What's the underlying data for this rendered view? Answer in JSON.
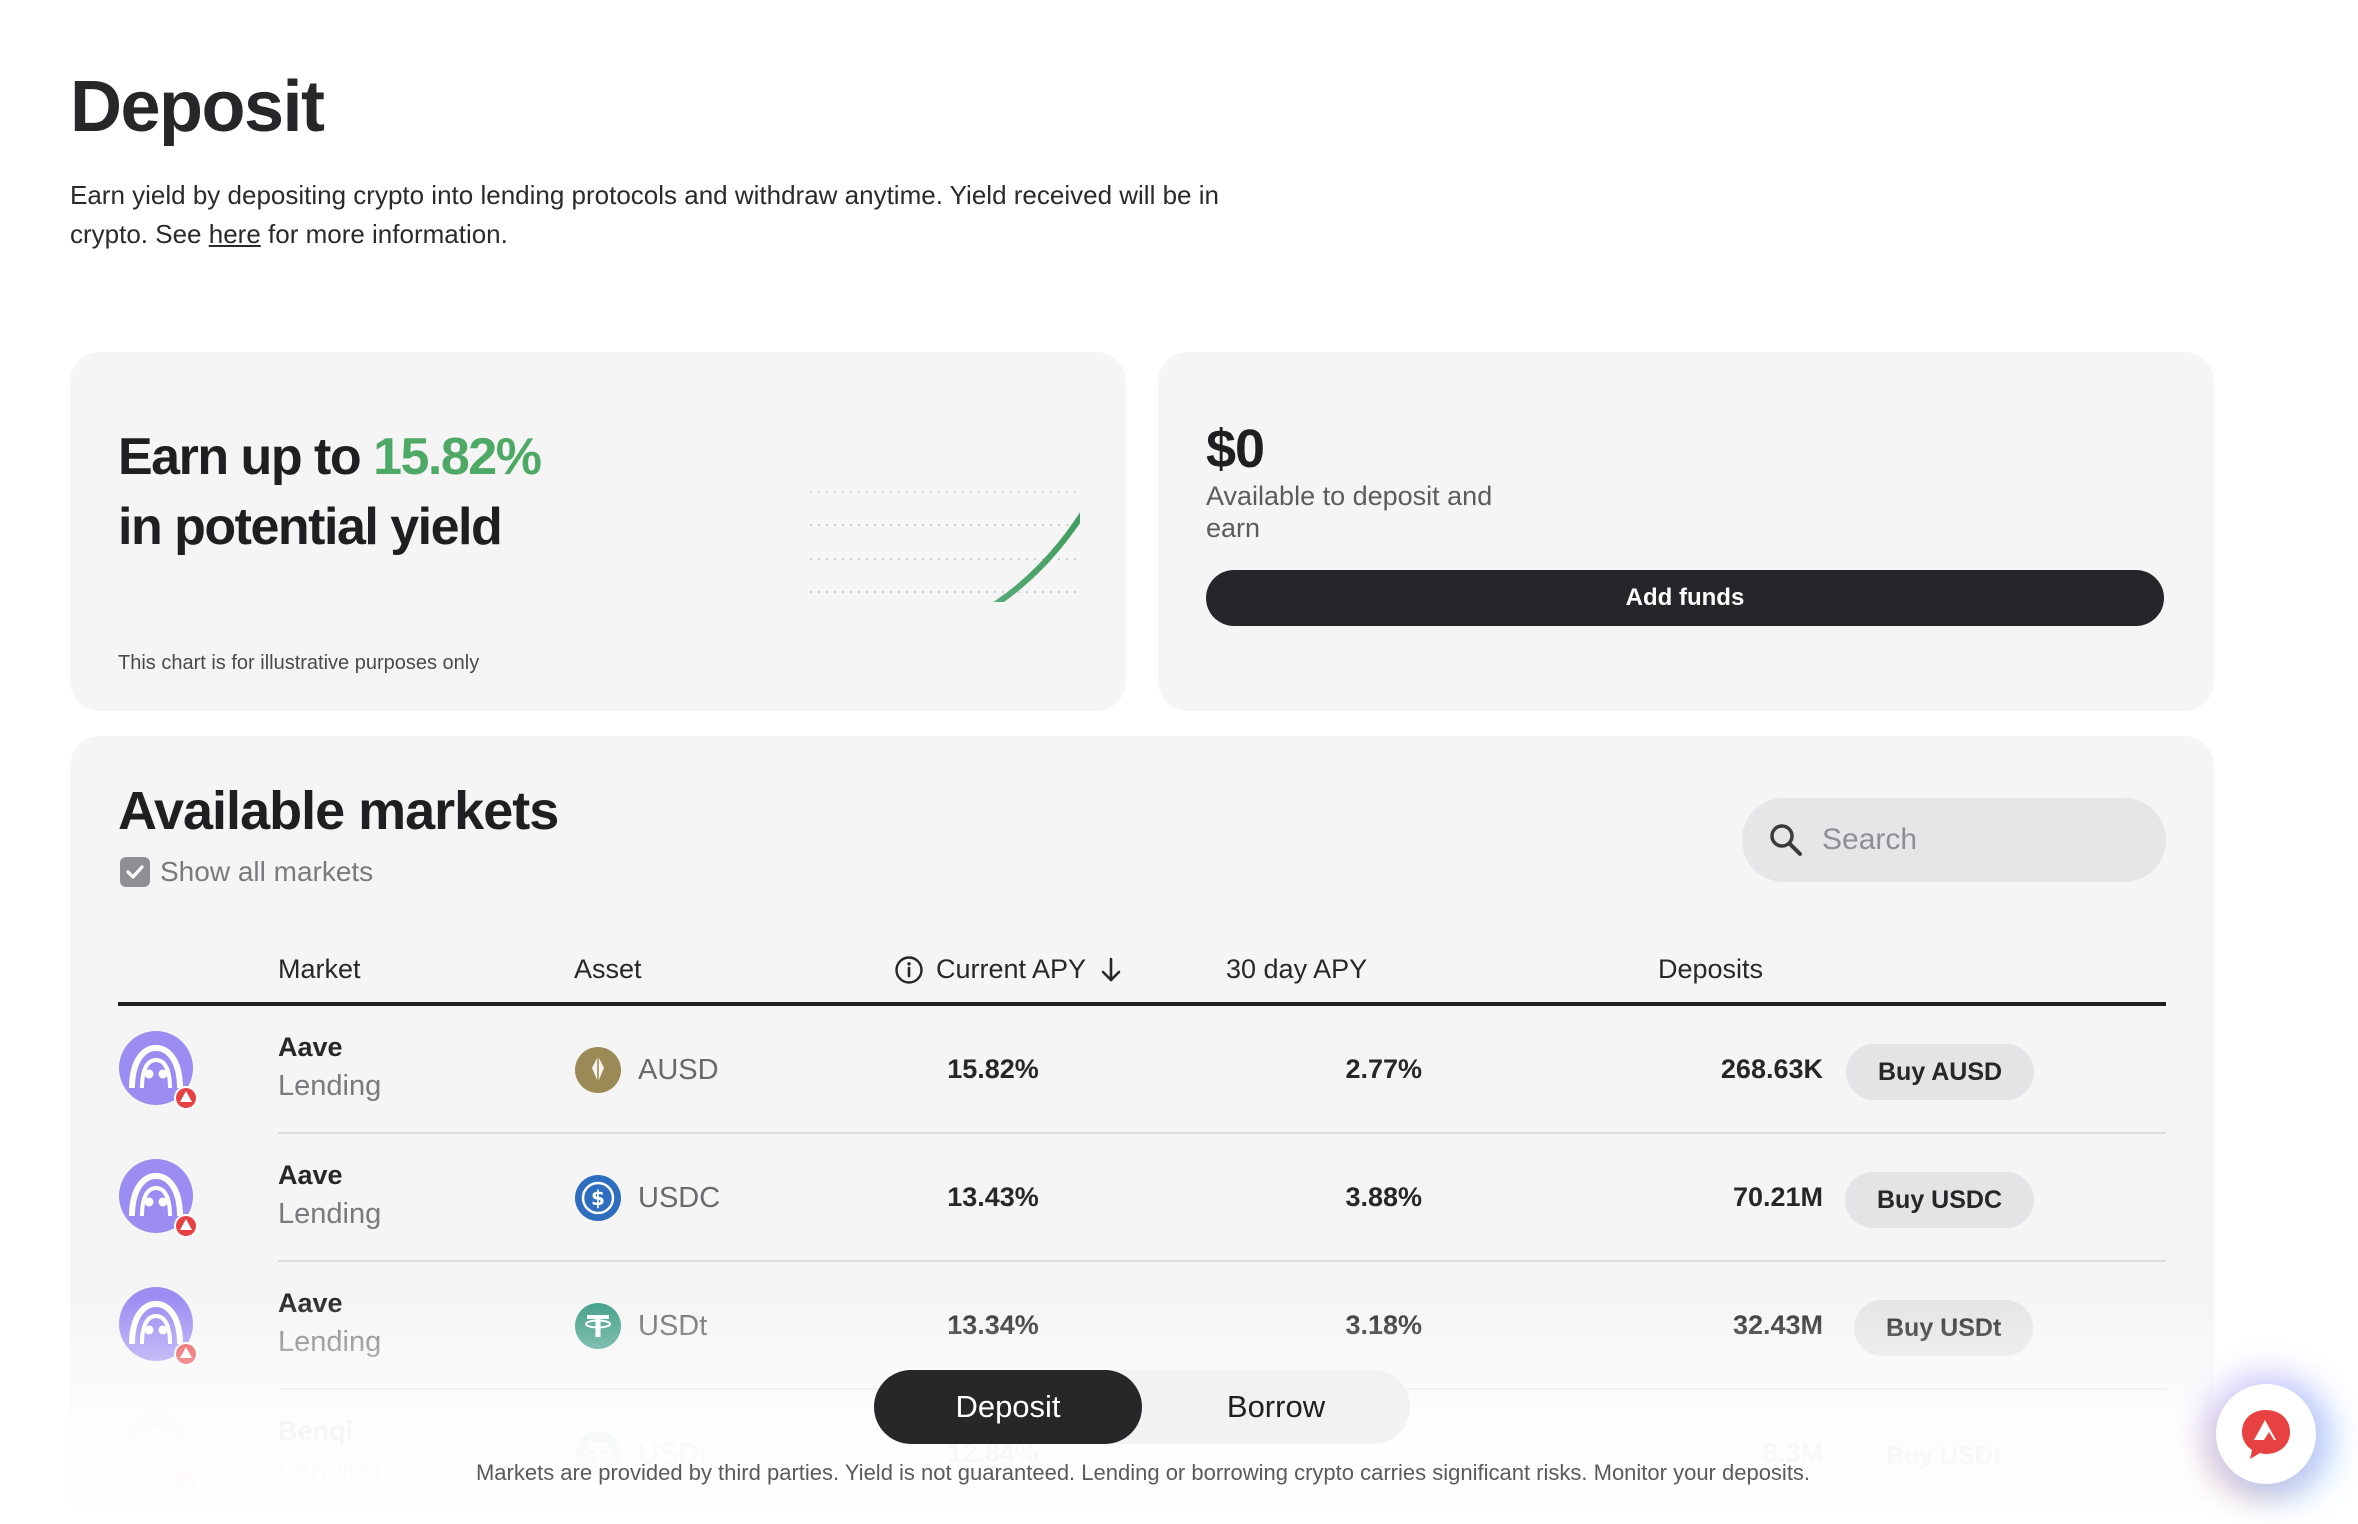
{
  "page": {
    "title": "Deposit",
    "intro_before": "Earn yield by depositing crypto into lending protocols and withdraw anytime. Yield received will be in crypto. See ",
    "intro_link": "here",
    "intro_after": " for more information."
  },
  "yield_card": {
    "line1_prefix": "Earn up to ",
    "line1_pct": "15.82%",
    "line2": "in potential yield",
    "disclaimer": "This chart is for illustrative purposes only"
  },
  "balance_card": {
    "amount": "$0",
    "label": "Available to deposit and earn",
    "add_funds": "Add funds"
  },
  "markets": {
    "title": "Available markets",
    "show_all_label": "Show all markets",
    "show_all_checked": true,
    "search_placeholder": "Search",
    "columns": {
      "market": "Market",
      "asset": "Asset",
      "current_apy": "Current APY",
      "apy_30d": "30 day APY",
      "deposits": "Deposits"
    },
    "rows": [
      {
        "protocol": "Aave",
        "type": "Lending",
        "asset": "AUSD",
        "asset_color": "#9a8a55",
        "current_apy": "15.82%",
        "apy_30d": "2.77%",
        "deposits": "268.63K",
        "buy": "Buy AUSD"
      },
      {
        "protocol": "Aave",
        "type": "Lending",
        "asset": "USDC",
        "asset_color": "#2f6ebf",
        "current_apy": "13.43%",
        "apy_30d": "3.88%",
        "deposits": "70.21M",
        "buy": "Buy USDC"
      },
      {
        "protocol": "Aave",
        "type": "Lending",
        "asset": "USDt",
        "asset_color": "#3f9e86",
        "current_apy": "13.34%",
        "apy_30d": "3.18%",
        "deposits": "32.43M",
        "buy": "Buy USDt"
      },
      {
        "protocol": "Benqi",
        "type": "Lending",
        "asset": "USDt",
        "asset_color": "#3f9e86",
        "current_apy": "12.84%",
        "apy_30d": "",
        "deposits": "8.3M",
        "buy": "Buy USDt"
      }
    ]
  },
  "tabs": {
    "deposit": "Deposit",
    "borrow": "Borrow",
    "active": "deposit"
  },
  "footer_note": "Markets are provided by third parties. Yield is not guaranteed. Lending or borrowing crypto carries significant risks. Monitor your deposits.",
  "colors": {
    "accent_green": "#4ea866",
    "aave_purple": "#9b8cf2",
    "avalanche_red": "#e84142"
  },
  "icons": {
    "fab": "avalanche-chat-icon",
    "search": "search-icon",
    "info": "info-icon",
    "sort": "arrow-down-icon"
  }
}
